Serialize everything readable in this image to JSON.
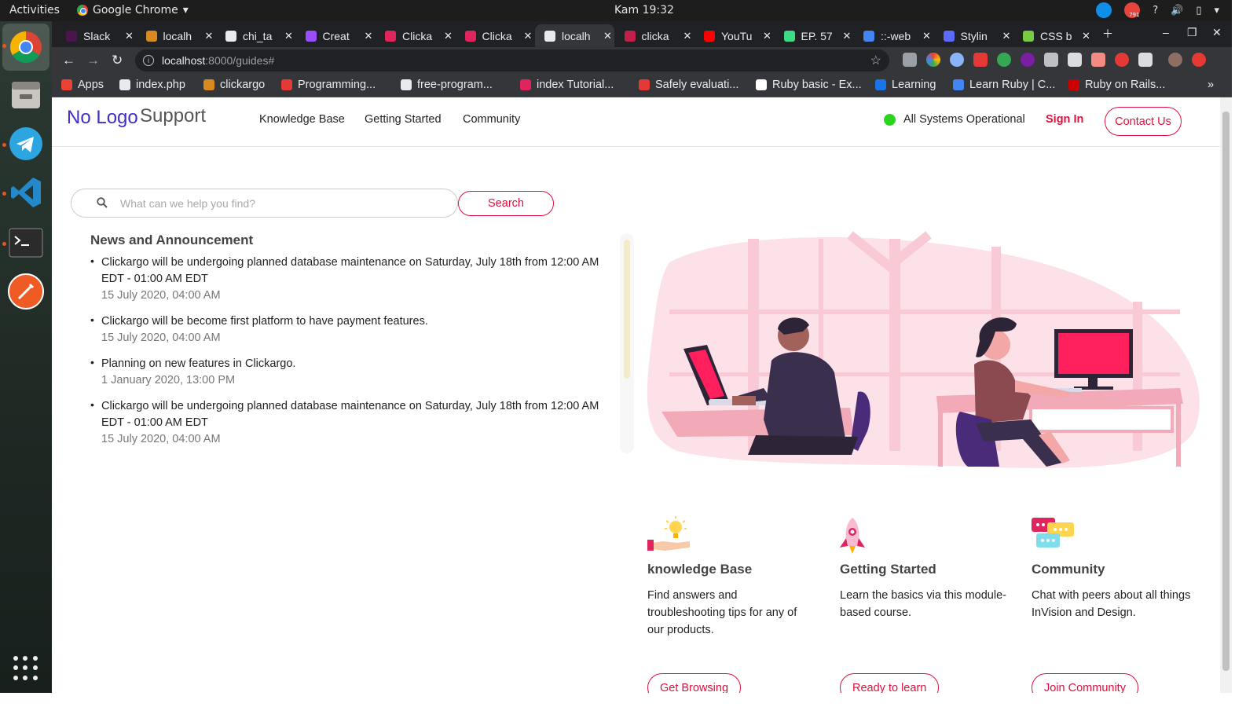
{
  "system": {
    "activities_label": "Activities",
    "app_menu_label": "Google Chrome",
    "clock": "Kam 19:32",
    "tray_badge": "791"
  },
  "browser": {
    "tabs": [
      {
        "label": "Slack",
        "color": "#4a154b"
      },
      {
        "label": "localh",
        "color": "#d68a1f"
      },
      {
        "label": "chi_ta",
        "color": "#e8eaed"
      },
      {
        "label": "Creat",
        "color": "#9b4dff"
      },
      {
        "label": "Clicka",
        "color": "#e0245e"
      },
      {
        "label": "Clicka",
        "color": "#e0245e"
      },
      {
        "label": "localh",
        "color": "#e8eaed"
      },
      {
        "label": "clicka",
        "color": "#c21f4a"
      },
      {
        "label": "YouTu",
        "color": "#ff0000"
      },
      {
        "label": "EP. 57",
        "color": "#3ddc84"
      },
      {
        "label": "::-web",
        "color": "#4285f4"
      },
      {
        "label": "Stylin",
        "color": "#5c6bff"
      },
      {
        "label": "CSS b",
        "color": "#7ac943"
      }
    ],
    "url_host": "localhost",
    "url_path": ":8000/guides#",
    "bookmarks": [
      {
        "label": "Apps",
        "color": "#ea4335"
      },
      {
        "label": "index.php",
        "color": "#e8eaed"
      },
      {
        "label": "clickargo",
        "color": "#d68a1f"
      },
      {
        "label": "Programming...",
        "color": "#e53935"
      },
      {
        "label": "free-program...",
        "color": "#e8eaed"
      },
      {
        "label": "index Tutorial...",
        "color": "#e0245e"
      },
      {
        "label": "Safely evaluati...",
        "color": "#e53935"
      },
      {
        "label": "Ruby basic - Ex...",
        "color": "#ffffff"
      },
      {
        "label": "Learning",
        "color": "#1a73e8"
      },
      {
        "label": "Learn Ruby | C...",
        "color": "#4285f4"
      },
      {
        "label": "Ruby on Rails...",
        "color": "#cc0000"
      }
    ],
    "more_label": "»"
  },
  "site": {
    "logo": "No Logo",
    "logo_sub": "Support",
    "nav": [
      "Knowledge Base",
      "Getting Started",
      "Community"
    ],
    "status_text": "All Systems Operational",
    "signin_label": "Sign In",
    "contact_label": "Contact Us",
    "search": {
      "placeholder": "What can we help you find?",
      "button_label": "Search"
    },
    "news": {
      "title": "News and Announcement",
      "items": [
        {
          "text": "Clickargo will be undergoing planned database maintenance on Saturday, July 18th from 12:00 AM EDT - 01:00 AM EDT",
          "date": "15 July 2020, 04:00 AM"
        },
        {
          "text": "Clickargo will be become first platform to have payment features.",
          "date": "15 July 2020, 04:00 AM"
        },
        {
          "text": "Planning on new features in Clickargo.",
          "date": "1 January 2020, 13:00 PM"
        },
        {
          "text": "Clickargo will be undergoing planned database maintenance on Saturday, July 18th from 12:00 AM EDT - 01:00 AM EDT",
          "date": "15 July 2020, 04:00 AM"
        }
      ]
    },
    "features": [
      {
        "icon": "lightbulb-hand-icon",
        "title": "knowledge Base",
        "desc": "Find answers and troubleshooting tips for any of our products.",
        "button": "Get Browsing"
      },
      {
        "icon": "rocket-icon",
        "title": "Getting Started",
        "desc": "Learn the basics via this module-based course.",
        "button": "Ready to learn"
      },
      {
        "icon": "chat-bubbles-icon",
        "title": "Community",
        "desc": "Chat with peers about all things InVision and Design.",
        "button": "Join Community"
      }
    ],
    "colors": {
      "accent": "#e0103e",
      "logo": "#3f2fc7",
      "status_ok": "#2bd41f"
    }
  }
}
